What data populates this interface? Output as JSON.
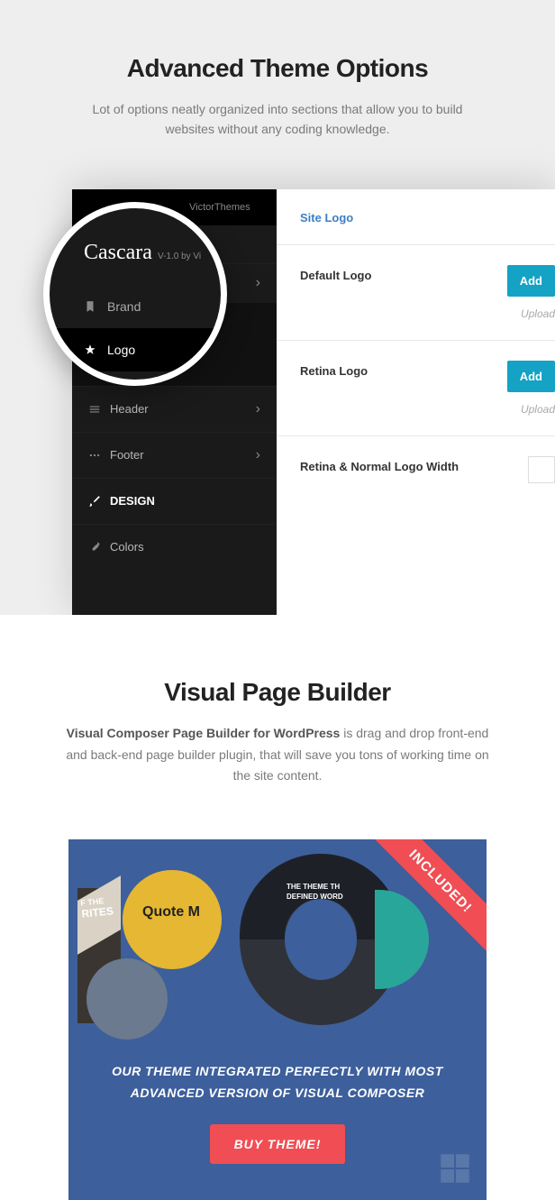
{
  "section1": {
    "title": "Advanced Theme Options",
    "subtitle": "Lot of options neatly organized into sections that allow you to build websites without any coding knowledge."
  },
  "topbar": {
    "vendor": "VictorThemes"
  },
  "magnifier": {
    "product": "Cascara",
    "version": "V-1.0 by Vi",
    "items": [
      {
        "label": "Brand",
        "selected": false
      },
      {
        "label": "Logo",
        "selected": true
      }
    ]
  },
  "sidebar": {
    "items": [
      {
        "label": "Header",
        "icon": "menu",
        "active": false
      },
      {
        "label": "Footer",
        "icon": "dots",
        "active": false
      },
      {
        "label": "DESIGN",
        "icon": "brush",
        "active": true
      },
      {
        "label": "Colors",
        "icon": "dropper",
        "active": false
      }
    ]
  },
  "main": {
    "heading": "Site Logo",
    "options": [
      {
        "label": "Default Logo",
        "button": "Add",
        "hint": "Upload"
      },
      {
        "label": "Retina Logo",
        "button": "Add",
        "hint": "Upload"
      },
      {
        "label": "Retina & Normal Logo Width",
        "input": true
      }
    ]
  },
  "section2": {
    "title": "Visual Page Builder",
    "sub_bold": "Visual Composer Page Builder for WordPress",
    "sub_rest": " is drag and drop front-end and back-end page builder plugin, that will save you tons of working time on the site content."
  },
  "promo": {
    "ribbon": "INCLUDED!",
    "quote": "Quote M",
    "bar_text1": "F THE",
    "bar_text2": "RITES",
    "ring_text1": "THE THEME TH",
    "ring_text2": "DEFINED WORD",
    "line1": "OUR THEME INTEGRATED PERFECTLY WITH MOST",
    "line2": "ADVANCED VERSION OF VISUAL COMPOSER",
    "cta": "BUY THEME!"
  }
}
